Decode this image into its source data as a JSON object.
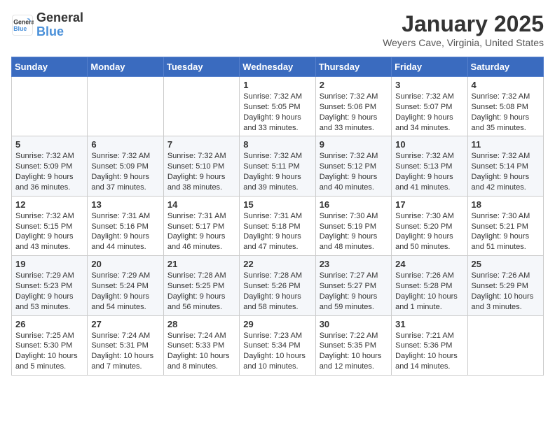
{
  "logo": {
    "general": "General",
    "blue": "Blue"
  },
  "title": "January 2025",
  "location": "Weyers Cave, Virginia, United States",
  "weekdays": [
    "Sunday",
    "Monday",
    "Tuesday",
    "Wednesday",
    "Thursday",
    "Friday",
    "Saturday"
  ],
  "weeks": [
    [
      {
        "day": "",
        "content": ""
      },
      {
        "day": "",
        "content": ""
      },
      {
        "day": "",
        "content": ""
      },
      {
        "day": "1",
        "content": "Sunrise: 7:32 AM\nSunset: 5:05 PM\nDaylight: 9 hours and 33 minutes."
      },
      {
        "day": "2",
        "content": "Sunrise: 7:32 AM\nSunset: 5:06 PM\nDaylight: 9 hours and 33 minutes."
      },
      {
        "day": "3",
        "content": "Sunrise: 7:32 AM\nSunset: 5:07 PM\nDaylight: 9 hours and 34 minutes."
      },
      {
        "day": "4",
        "content": "Sunrise: 7:32 AM\nSunset: 5:08 PM\nDaylight: 9 hours and 35 minutes."
      }
    ],
    [
      {
        "day": "5",
        "content": "Sunrise: 7:32 AM\nSunset: 5:09 PM\nDaylight: 9 hours and 36 minutes."
      },
      {
        "day": "6",
        "content": "Sunrise: 7:32 AM\nSunset: 5:09 PM\nDaylight: 9 hours and 37 minutes."
      },
      {
        "day": "7",
        "content": "Sunrise: 7:32 AM\nSunset: 5:10 PM\nDaylight: 9 hours and 38 minutes."
      },
      {
        "day": "8",
        "content": "Sunrise: 7:32 AM\nSunset: 5:11 PM\nDaylight: 9 hours and 39 minutes."
      },
      {
        "day": "9",
        "content": "Sunrise: 7:32 AM\nSunset: 5:12 PM\nDaylight: 9 hours and 40 minutes."
      },
      {
        "day": "10",
        "content": "Sunrise: 7:32 AM\nSunset: 5:13 PM\nDaylight: 9 hours and 41 minutes."
      },
      {
        "day": "11",
        "content": "Sunrise: 7:32 AM\nSunset: 5:14 PM\nDaylight: 9 hours and 42 minutes."
      }
    ],
    [
      {
        "day": "12",
        "content": "Sunrise: 7:32 AM\nSunset: 5:15 PM\nDaylight: 9 hours and 43 minutes."
      },
      {
        "day": "13",
        "content": "Sunrise: 7:31 AM\nSunset: 5:16 PM\nDaylight: 9 hours and 44 minutes."
      },
      {
        "day": "14",
        "content": "Sunrise: 7:31 AM\nSunset: 5:17 PM\nDaylight: 9 hours and 46 minutes."
      },
      {
        "day": "15",
        "content": "Sunrise: 7:31 AM\nSunset: 5:18 PM\nDaylight: 9 hours and 47 minutes."
      },
      {
        "day": "16",
        "content": "Sunrise: 7:30 AM\nSunset: 5:19 PM\nDaylight: 9 hours and 48 minutes."
      },
      {
        "day": "17",
        "content": "Sunrise: 7:30 AM\nSunset: 5:20 PM\nDaylight: 9 hours and 50 minutes."
      },
      {
        "day": "18",
        "content": "Sunrise: 7:30 AM\nSunset: 5:21 PM\nDaylight: 9 hours and 51 minutes."
      }
    ],
    [
      {
        "day": "19",
        "content": "Sunrise: 7:29 AM\nSunset: 5:23 PM\nDaylight: 9 hours and 53 minutes."
      },
      {
        "day": "20",
        "content": "Sunrise: 7:29 AM\nSunset: 5:24 PM\nDaylight: 9 hours and 54 minutes."
      },
      {
        "day": "21",
        "content": "Sunrise: 7:28 AM\nSunset: 5:25 PM\nDaylight: 9 hours and 56 minutes."
      },
      {
        "day": "22",
        "content": "Sunrise: 7:28 AM\nSunset: 5:26 PM\nDaylight: 9 hours and 58 minutes."
      },
      {
        "day": "23",
        "content": "Sunrise: 7:27 AM\nSunset: 5:27 PM\nDaylight: 9 hours and 59 minutes."
      },
      {
        "day": "24",
        "content": "Sunrise: 7:26 AM\nSunset: 5:28 PM\nDaylight: 10 hours and 1 minute."
      },
      {
        "day": "25",
        "content": "Sunrise: 7:26 AM\nSunset: 5:29 PM\nDaylight: 10 hours and 3 minutes."
      }
    ],
    [
      {
        "day": "26",
        "content": "Sunrise: 7:25 AM\nSunset: 5:30 PM\nDaylight: 10 hours and 5 minutes."
      },
      {
        "day": "27",
        "content": "Sunrise: 7:24 AM\nSunset: 5:31 PM\nDaylight: 10 hours and 7 minutes."
      },
      {
        "day": "28",
        "content": "Sunrise: 7:24 AM\nSunset: 5:33 PM\nDaylight: 10 hours and 8 minutes."
      },
      {
        "day": "29",
        "content": "Sunrise: 7:23 AM\nSunset: 5:34 PM\nDaylight: 10 hours and 10 minutes."
      },
      {
        "day": "30",
        "content": "Sunrise: 7:22 AM\nSunset: 5:35 PM\nDaylight: 10 hours and 12 minutes."
      },
      {
        "day": "31",
        "content": "Sunrise: 7:21 AM\nSunset: 5:36 PM\nDaylight: 10 hours and 14 minutes."
      },
      {
        "day": "",
        "content": ""
      }
    ]
  ]
}
